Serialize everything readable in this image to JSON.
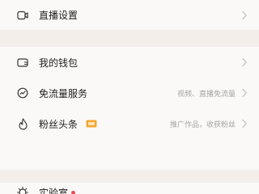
{
  "sections": {
    "top": {
      "items": [
        {
          "label": "直播设置",
          "icon": "video-camera-icon"
        }
      ]
    },
    "middle": {
      "items": [
        {
          "label": "我的钱包",
          "icon": "wallet-icon",
          "detail": ""
        },
        {
          "label": "免流量服务",
          "icon": "speed-gauge-icon",
          "detail": "视频、直播免流量"
        },
        {
          "label": "粉丝头条",
          "icon": "flame-icon",
          "detail": "推广作品，收获粉丝",
          "badge_icon": "ticket-icon"
        }
      ]
    },
    "bottom": {
      "items": [
        {
          "label": "实验室",
          "icon": "lightbulb-icon",
          "has_dot": true
        }
      ]
    }
  },
  "colors": {
    "background": "#f3eeea",
    "card": "#fbf9f8",
    "text_primary": "#1f1f1f",
    "text_secondary": "#a6a3a1",
    "chevron": "#c8c5c3",
    "badge": "#f4a630",
    "dot": "#f04b5a"
  }
}
